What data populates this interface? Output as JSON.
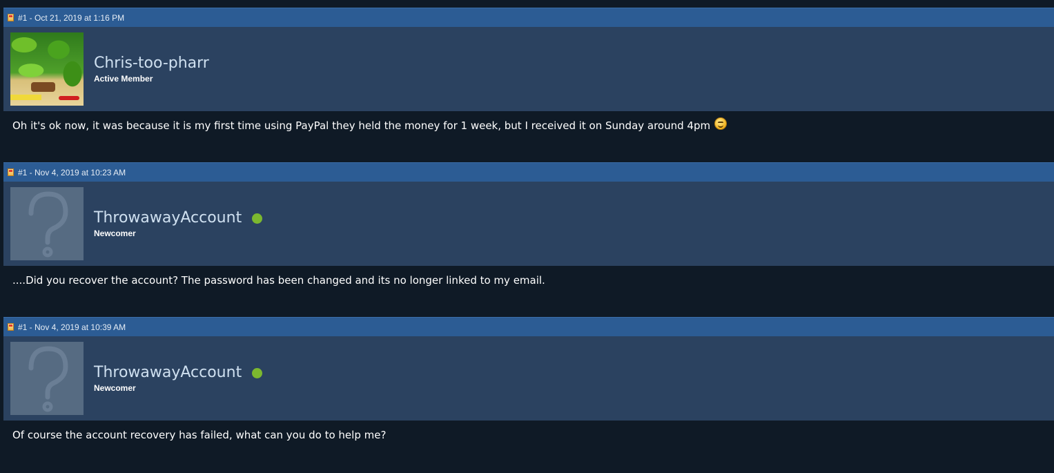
{
  "posts": [
    {
      "header": "#1 - Oct 21, 2019 at 1:16 PM",
      "username": "Chris-too-pharr",
      "user_title": "Active Member",
      "avatar": "custom-avatar",
      "online": false,
      "body": "Oh it's ok now, it was because it is my first time using PayPal they held the money for 1 week, but I received it on Sunday around 4pm",
      "emoji": "smiley-icon"
    },
    {
      "header": "#1 - Nov 4, 2019 at 10:23 AM",
      "username": "ThrowawayAccount",
      "user_title": "Newcomer",
      "avatar": "default-avatar",
      "online": true,
      "body": "....Did you recover the account? The password has been changed and its no longer linked to my email."
    },
    {
      "header": "#1 - Nov 4, 2019 at 10:39 AM",
      "username": "ThrowawayAccount",
      "user_title": "Newcomer",
      "avatar": "default-avatar",
      "online": true,
      "body": "Of course the account recovery has failed, what can you do to help me?"
    }
  ],
  "colors": {
    "header_bg": "#2c5c94",
    "user_bar_bg": "#2b4260",
    "body_bg": "#0f1a26",
    "online": "#7cb82f"
  }
}
